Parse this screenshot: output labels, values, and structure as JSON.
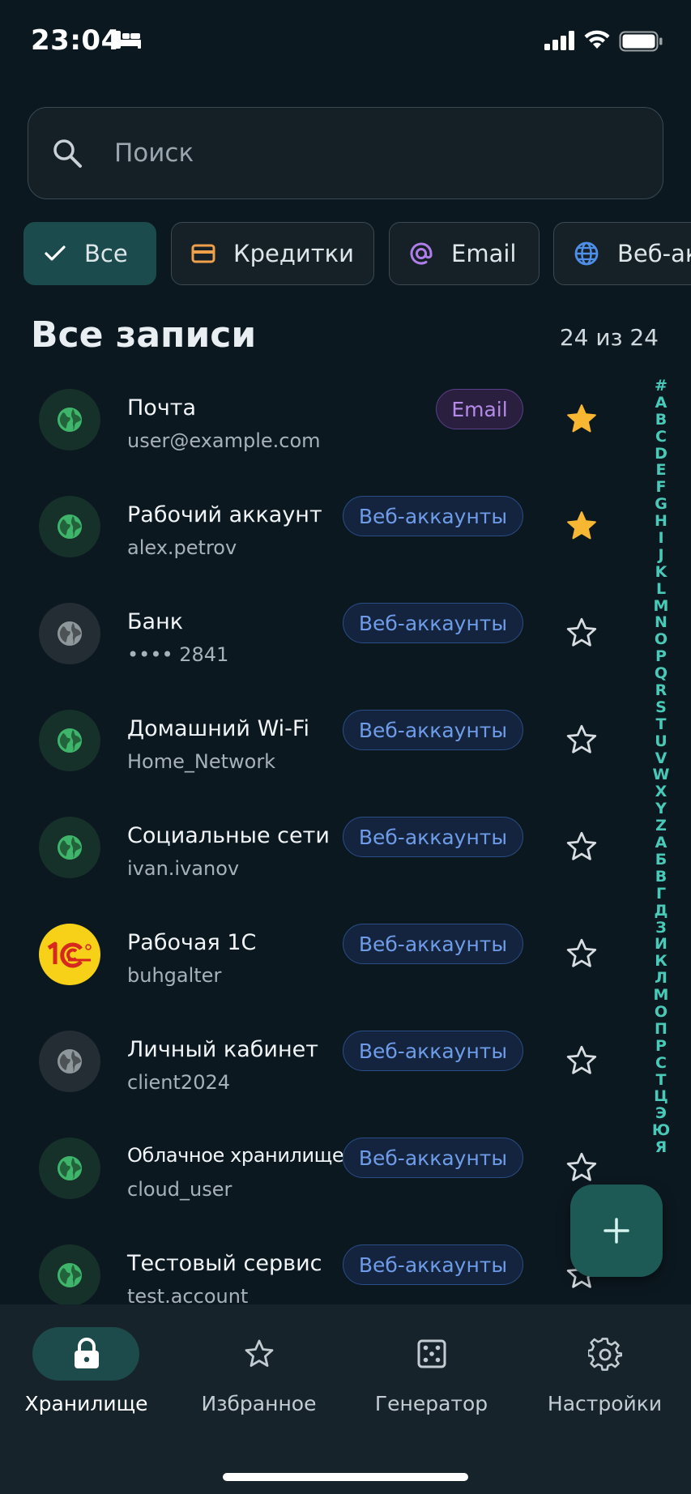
{
  "status_bar": {
    "time": "23:04"
  },
  "search": {
    "placeholder": "Поиск"
  },
  "filters": [
    {
      "label": "Все",
      "icon": "check-icon",
      "active": true
    },
    {
      "label": "Кредитки",
      "icon": "credit-card-icon",
      "color": "#f0a04b"
    },
    {
      "label": "Email",
      "icon": "at-icon",
      "color": "#b07ee8"
    },
    {
      "label": "Веб-аккаунты",
      "icon": "globe-icon",
      "color": "#4f8fe8"
    }
  ],
  "section": {
    "title": "Все записи",
    "count": "24 из 24"
  },
  "entries": [
    {
      "title": "Почта",
      "subtitle": "user@example.com",
      "badge": "Email",
      "favorite": true,
      "avatar": "globe-icon"
    },
    {
      "title": "Рабочий аккаунт",
      "subtitle": "alex.petrov",
      "badge": "Веб-аккаунты",
      "favorite": true,
      "avatar": "globe-icon"
    },
    {
      "title": "Банк",
      "subtitle": "•••• 2841",
      "badge": "Веб-аккаунты",
      "favorite": false,
      "avatar": "globe-icon"
    },
    {
      "title": "Домашний Wi-Fi",
      "subtitle": "Home_Network",
      "badge": "Веб-аккаунты",
      "favorite": false,
      "avatar": "globe-icon"
    },
    {
      "title": "Социальные сети",
      "subtitle": "ivan.ivanov",
      "badge": "Веб-аккаунты",
      "favorite": false,
      "avatar": "globe-icon"
    },
    {
      "title": "Рабочая 1С",
      "subtitle": "buhgalter",
      "badge": "Веб-аккаунты",
      "favorite": false,
      "avatar": "1c-logo"
    },
    {
      "title": "Личный кабинет",
      "subtitle": "client2024",
      "badge": "Веб-аккаунты",
      "favorite": false,
      "avatar": "globe-icon"
    },
    {
      "title": "Облачное хранилище",
      "subtitle": "cloud_user",
      "badge": "Веб-аккаунты",
      "favorite": false,
      "avatar": "globe-icon"
    },
    {
      "title": "Тестовый сервис",
      "subtitle": "test.account",
      "badge": "Веб-аккаунты",
      "favorite": false,
      "avatar": "globe-icon"
    }
  ],
  "alphabet": [
    "#",
    "A",
    "B",
    "C",
    "D",
    "E",
    "F",
    "G",
    "H",
    "I",
    "J",
    "K",
    "L",
    "M",
    "N",
    "O",
    "P",
    "Q",
    "R",
    "S",
    "T",
    "U",
    "V",
    "W",
    "X",
    "Y",
    "Z",
    "А",
    "Б",
    "В",
    "Г",
    "Д",
    "З",
    "И",
    "К",
    "Л",
    "М",
    "О",
    "П",
    "Р",
    "С",
    "Т",
    "Ц",
    "Э",
    "Ю",
    "Я"
  ],
  "bottom_nav": [
    {
      "label": "Хранилище",
      "icon": "lock-icon",
      "active": true
    },
    {
      "label": "Избранное",
      "icon": "star-icon"
    },
    {
      "label": "Генератор",
      "icon": "dice-icon"
    },
    {
      "label": "Настройки",
      "icon": "gear-icon"
    }
  ],
  "colors": {
    "background": "#0c1820",
    "accent": "#1d5a55",
    "alphabet": "#49c9b8",
    "favorite": "#f7b733"
  }
}
